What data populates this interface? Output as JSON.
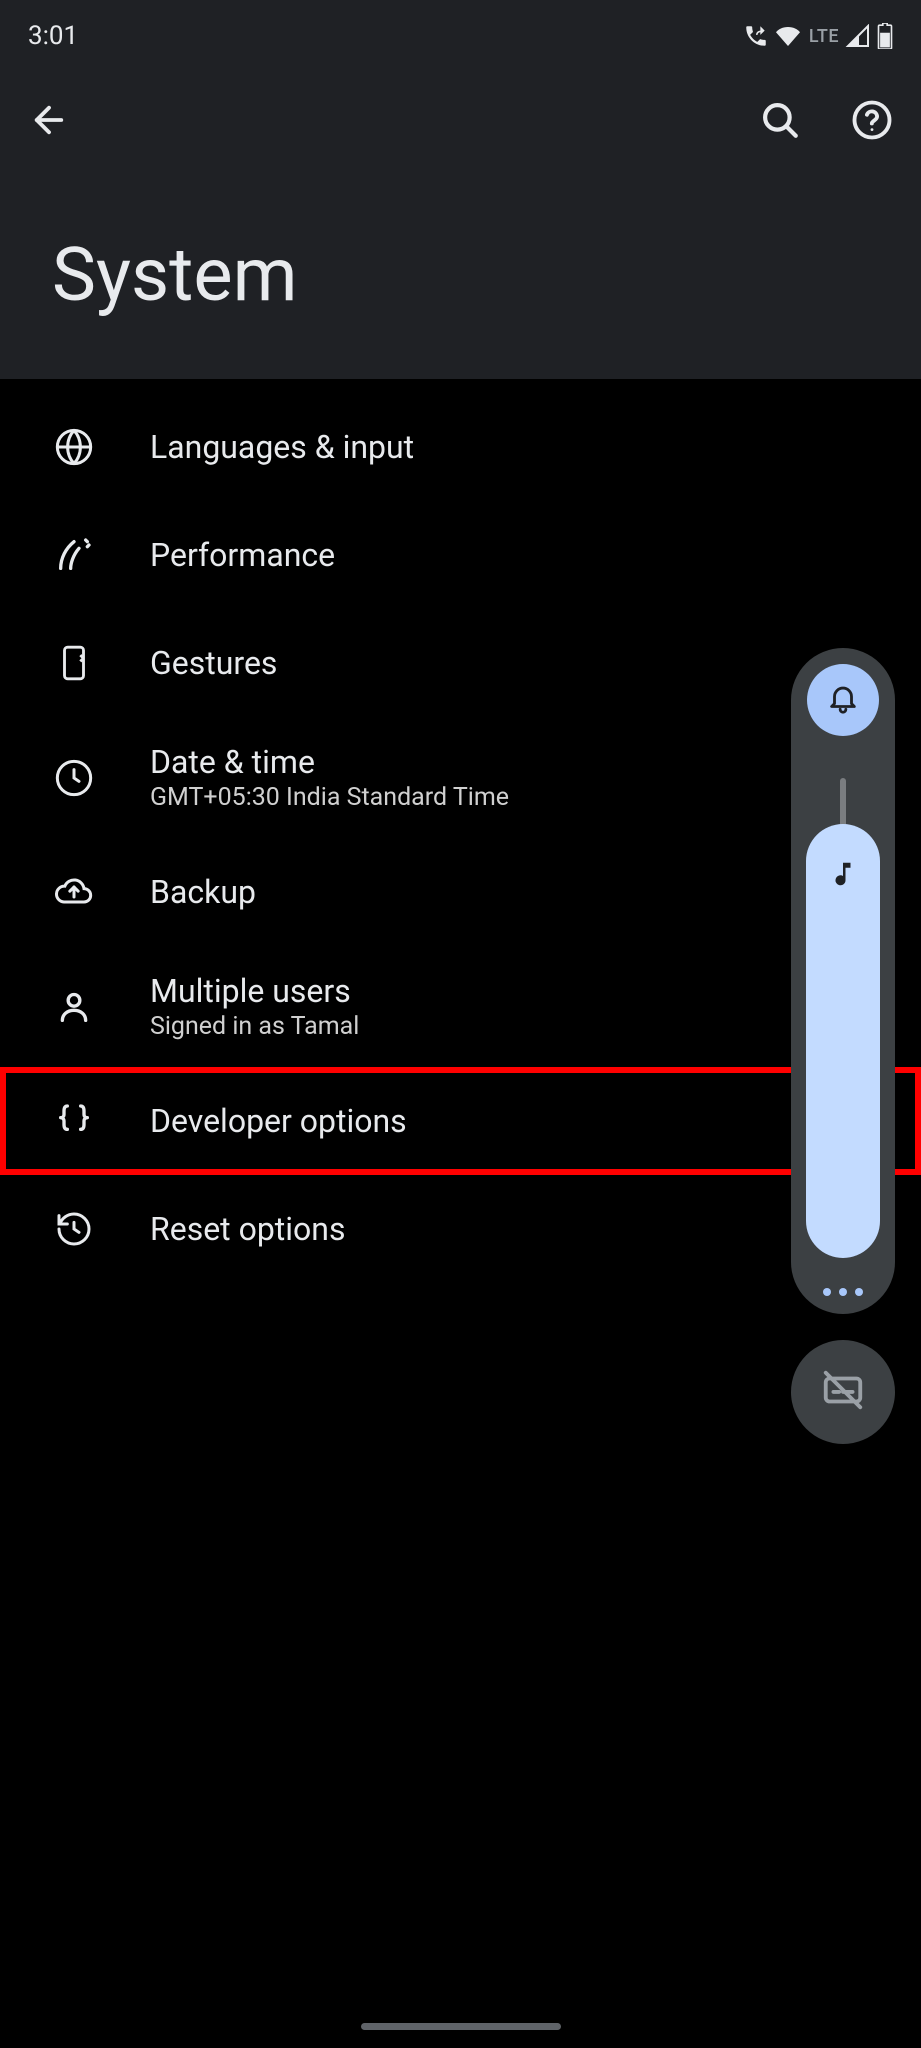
{
  "status": {
    "time": "3:01",
    "network_label": "LTE"
  },
  "header": {
    "title": "System"
  },
  "settings": {
    "items": [
      {
        "title": "Languages & input",
        "subtitle": ""
      },
      {
        "title": "Performance",
        "subtitle": ""
      },
      {
        "title": "Gestures",
        "subtitle": ""
      },
      {
        "title": "Date & time",
        "subtitle": "GMT+05:30 India Standard Time"
      },
      {
        "title": "Backup",
        "subtitle": ""
      },
      {
        "title": "Multiple users",
        "subtitle": "Signed in as Tamal"
      },
      {
        "title": "Developer options",
        "subtitle": ""
      },
      {
        "title": "Reset options",
        "subtitle": ""
      }
    ]
  },
  "highlighted_item_index": 6,
  "volume": {
    "mode": "ring",
    "media_icon": "music-note"
  }
}
